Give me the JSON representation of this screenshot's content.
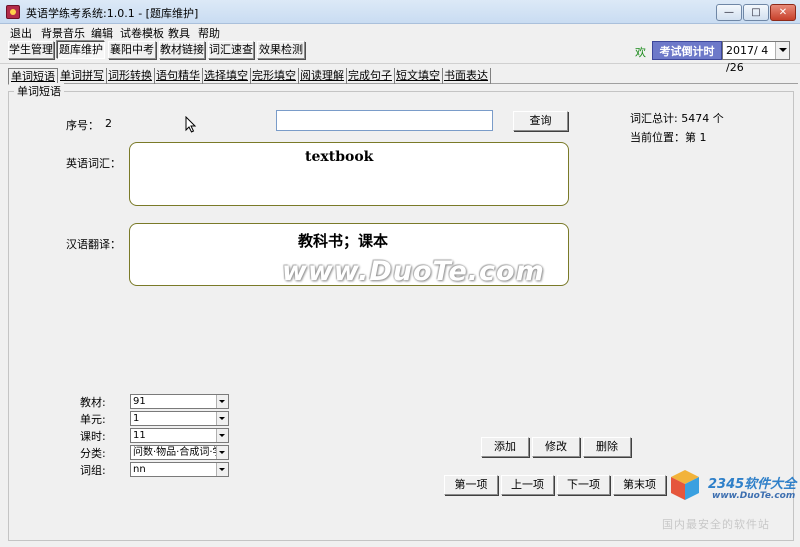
{
  "window": {
    "title": "英语学练考系统:1.0.1 - [题库维护]",
    "minimize": "—",
    "maximize": "□",
    "close": "✕"
  },
  "menu": [
    "退出",
    "背景音乐",
    "编辑",
    "试卷模板",
    "教具",
    "帮助"
  ],
  "nav": {
    "buttons": [
      "学生管理",
      "题库维护",
      "襄阳中考",
      "教材链接",
      "词汇速查",
      "效果检测"
    ],
    "active_index": 1,
    "greeting": "欢",
    "countdown_label": "考试倒计时",
    "date": "2017/ 4 /26"
  },
  "tabs": [
    "单词短语",
    "单词拼写",
    "词形转换",
    "语句精华",
    "选择填空",
    "完形填空",
    "阅读理解",
    "完成句子",
    "短文填空",
    "书面表达"
  ],
  "active_tab": 0,
  "group_label": "单词短语",
  "form": {
    "seq_label": "序号：",
    "seq_value": "2",
    "search_value": "",
    "search_button": "查询",
    "total_label": "词汇总计: 5474 个",
    "position_label": "当前位置：第 1",
    "english_label": "英语词汇：",
    "english_value": "textbook",
    "chinese_label": "汉语翻译：",
    "chinese_value": "教科书；课本"
  },
  "filters": {
    "textbook_label": "教材:",
    "textbook_value": "91",
    "unit_label": "单元:",
    "unit_value": "1",
    "lesson_label": "课时:",
    "lesson_value": "11",
    "category_label": "分类:",
    "category_value": "问数·物品·合成词·学",
    "group_label": "词组:",
    "group_value": "nn"
  },
  "actions": {
    "add": "添加",
    "edit": "修改",
    "delete": "删除",
    "first": "第一项",
    "prev": "上一项",
    "next": "下一项",
    "last": "第末项"
  },
  "watermark": "www.DuoTe.com",
  "brand": {
    "name": "2345软件大全",
    "url": "www.DuoTe.com",
    "tagline": "国内最安全的软件站"
  },
  "colors": {
    "countdown_bg": "#6d79c9",
    "greeting": "#1a8a1a",
    "box_border": "#7a7a28"
  }
}
